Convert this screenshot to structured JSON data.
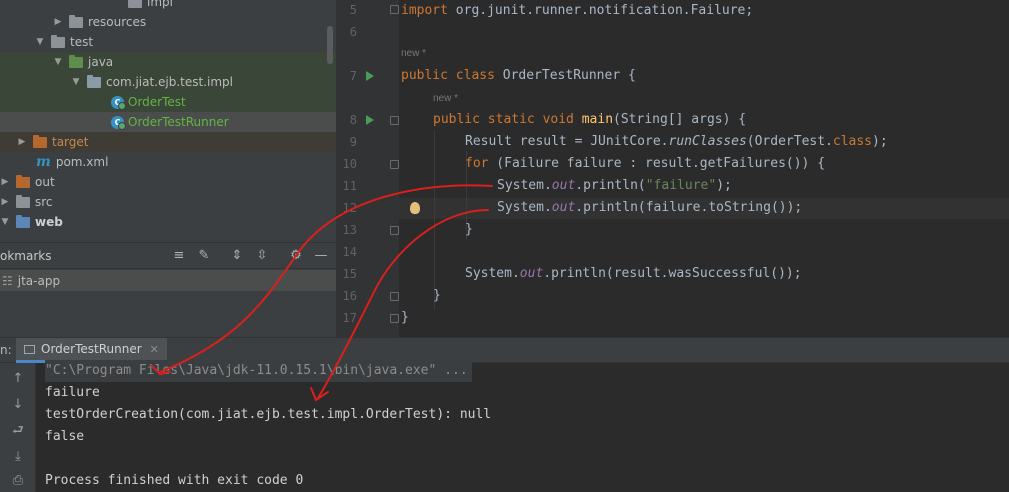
{
  "project_tree": {
    "rows": [
      {
        "label": "impl"
      },
      {
        "label": "resources"
      },
      {
        "label": "test"
      },
      {
        "label": "java"
      },
      {
        "label": "com.jiat.ejb.test.impl"
      },
      {
        "label": "OrderTest"
      },
      {
        "label": "OrderTestRunner"
      },
      {
        "label": "target"
      },
      {
        "label": "pom.xml"
      },
      {
        "label": "out"
      },
      {
        "label": "src"
      },
      {
        "label": "web"
      }
    ]
  },
  "bookmarks": {
    "title": "okmarks",
    "item": "jta-app"
  },
  "editor": {
    "line_numbers": [
      "5",
      "6",
      "7",
      "8",
      "9",
      "10",
      "11",
      "12",
      "13",
      "14",
      "15",
      "16",
      "17"
    ],
    "hint_class": "new *",
    "hint_method": "new *",
    "lines": {
      "l5_kw": "import",
      "l5_rest": " org.junit.runner.notification.Failure;",
      "l7_kw": "public class",
      "l7_rest": " OrderTestRunner {",
      "l8_kw": "public static void",
      "l8_name": " main",
      "l8_rest": "(String[] args) {",
      "l9_a": "Result result = JUnitCore.",
      "l9_m": "runClasses",
      "l9_b": "(OrderTest.",
      "l9_kw": "class",
      "l9_c": ");",
      "l10_kw": "for",
      "l10_rest": " (Failure failure : result.getFailures()) {",
      "l11_a": "System.",
      "l11_f": "out",
      "l11_b": ".println(",
      "l11_s": "\"failure\"",
      "l11_c": ");",
      "l12_a": "System.",
      "l12_f": "out",
      "l12_b": ".println(failure.toString());",
      "l13": "}",
      "l15_a": "System.",
      "l15_f": "out",
      "l15_b": ".println(result.wasSuccessful());",
      "l16": "}",
      "l17": "}"
    }
  },
  "run_panel": {
    "prefix": "n:",
    "tab_label": "OrderTestRunner",
    "console": {
      "cmd": "\"C:\\Program Files\\Java\\jdk-11.0.15.1\\bin\\java.exe\" ...",
      "line1": "failure",
      "line2": "testOrderCreation(com.jiat.ejb.test.impl.OrderTest): null",
      "line3": "false",
      "line4": "Process finished with exit code 0"
    }
  },
  "colors": {
    "annotation": "#d9201c"
  }
}
